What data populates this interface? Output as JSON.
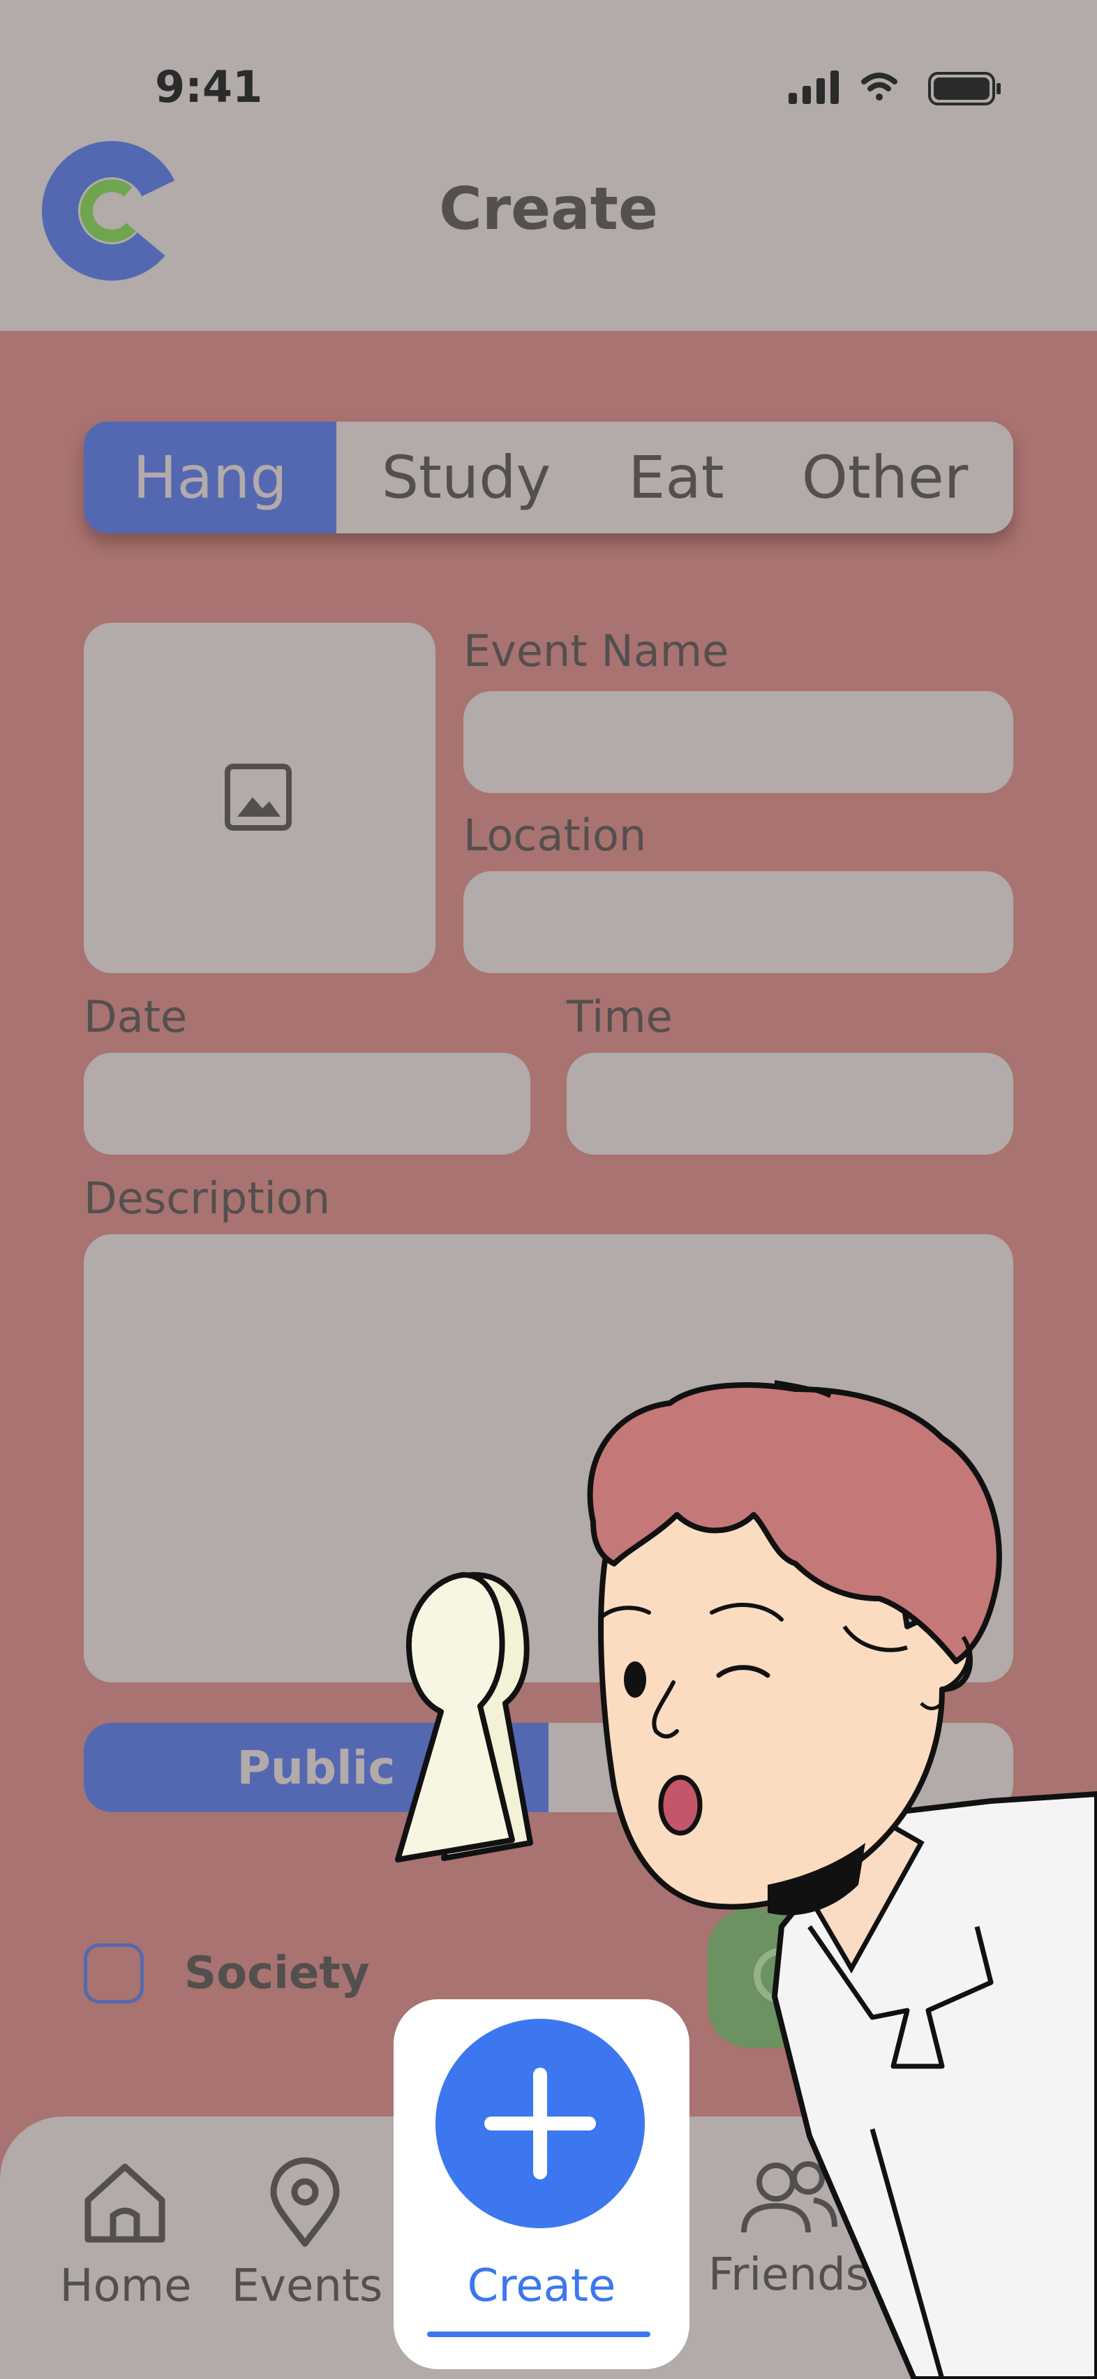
{
  "status_bar": {
    "time": "9:41",
    "icons": [
      "signal-icon",
      "wifi-icon",
      "battery-icon"
    ]
  },
  "header": {
    "title": "Create",
    "logo": "app-logo"
  },
  "tabs": [
    {
      "label": "Hang",
      "active": true
    },
    {
      "label": "Study",
      "active": false
    },
    {
      "label": "Eat",
      "active": false
    },
    {
      "label": "Other",
      "active": false
    }
  ],
  "form": {
    "image_placeholder_icon": "image-icon",
    "event_name": {
      "label": "Event Name",
      "value": ""
    },
    "location": {
      "label": "Location",
      "value": ""
    },
    "date": {
      "label": "Date",
      "value": ""
    },
    "time": {
      "label": "Time",
      "value": ""
    },
    "description": {
      "label": "Description",
      "value": ""
    },
    "visibility": {
      "selected": "Public"
    },
    "society": {
      "label": "Society",
      "checked": false
    }
  },
  "bottom_nav": {
    "items": [
      {
        "label": "Home",
        "icon": "home-icon"
      },
      {
        "label": "Events",
        "icon": "location-pin-icon"
      },
      {
        "label": "Create",
        "icon": "plus-icon",
        "active": true
      },
      {
        "label": "Friends",
        "icon": "friends-icon"
      }
    ]
  },
  "colors": {
    "background": "#a87370",
    "surface": "#b3aaaa",
    "accent": "#5468b2",
    "create_blue": "#3c77f0",
    "submit_green": "#6b9260"
  }
}
